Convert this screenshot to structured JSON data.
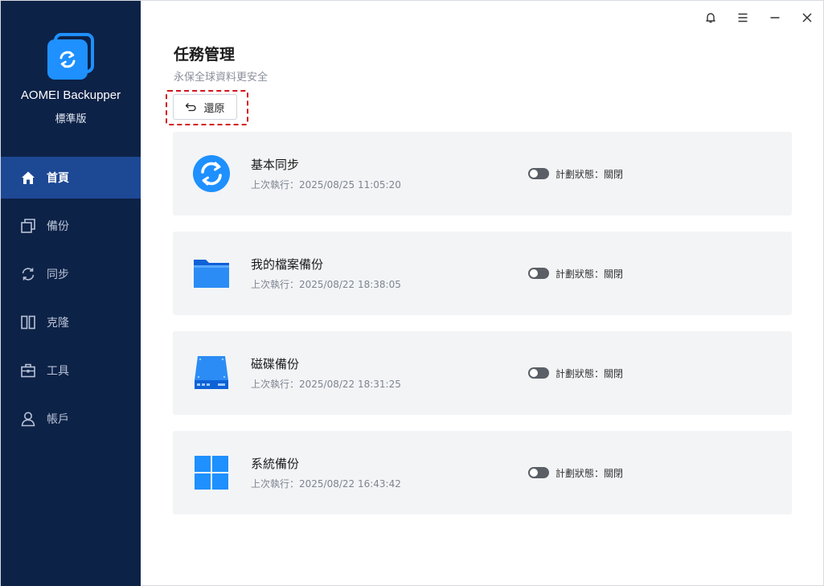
{
  "app": {
    "name": "AOMEI Backupper",
    "edition": "標準版"
  },
  "sidebar": {
    "items": [
      {
        "label": "首頁",
        "icon": "home-icon",
        "active": true
      },
      {
        "label": "備份",
        "icon": "backup-icon"
      },
      {
        "label": "同步",
        "icon": "sync-icon"
      },
      {
        "label": "克隆",
        "icon": "clone-icon"
      },
      {
        "label": "工具",
        "icon": "tools-icon"
      },
      {
        "label": "帳戶",
        "icon": "account-icon"
      }
    ]
  },
  "titlebar": {
    "icons": [
      "bell-icon",
      "menu-icon",
      "minimize-icon",
      "close-icon"
    ]
  },
  "header": {
    "title": "任務管理",
    "subtitle": "永保全球資料更安全",
    "restore_label": "還原"
  },
  "tasks": [
    {
      "name": "基本同步",
      "last_run": "上次執行：2025/08/25 11:05:20",
      "status": "計劃狀態：關閉",
      "icon": "sync-task-icon"
    },
    {
      "name": "我的檔案備份",
      "last_run": "上次執行：2025/08/22 18:38:05",
      "status": "計劃狀態：關閉",
      "icon": "folder-icon"
    },
    {
      "name": "磁碟備份",
      "last_run": "上次執行：2025/08/22 18:31:25",
      "status": "計劃狀態：關閉",
      "icon": "disk-icon"
    },
    {
      "name": "系統備份",
      "last_run": "上次執行：2025/08/22 16:43:42",
      "status": "計劃狀態：關閉",
      "icon": "windows-icon"
    }
  ],
  "colors": {
    "sidebar_bg": "#0d2247",
    "sidebar_active": "#1d4894",
    "accent": "#1e90ff",
    "card_bg": "#f3f4f6",
    "highlight": "#d4141a"
  }
}
